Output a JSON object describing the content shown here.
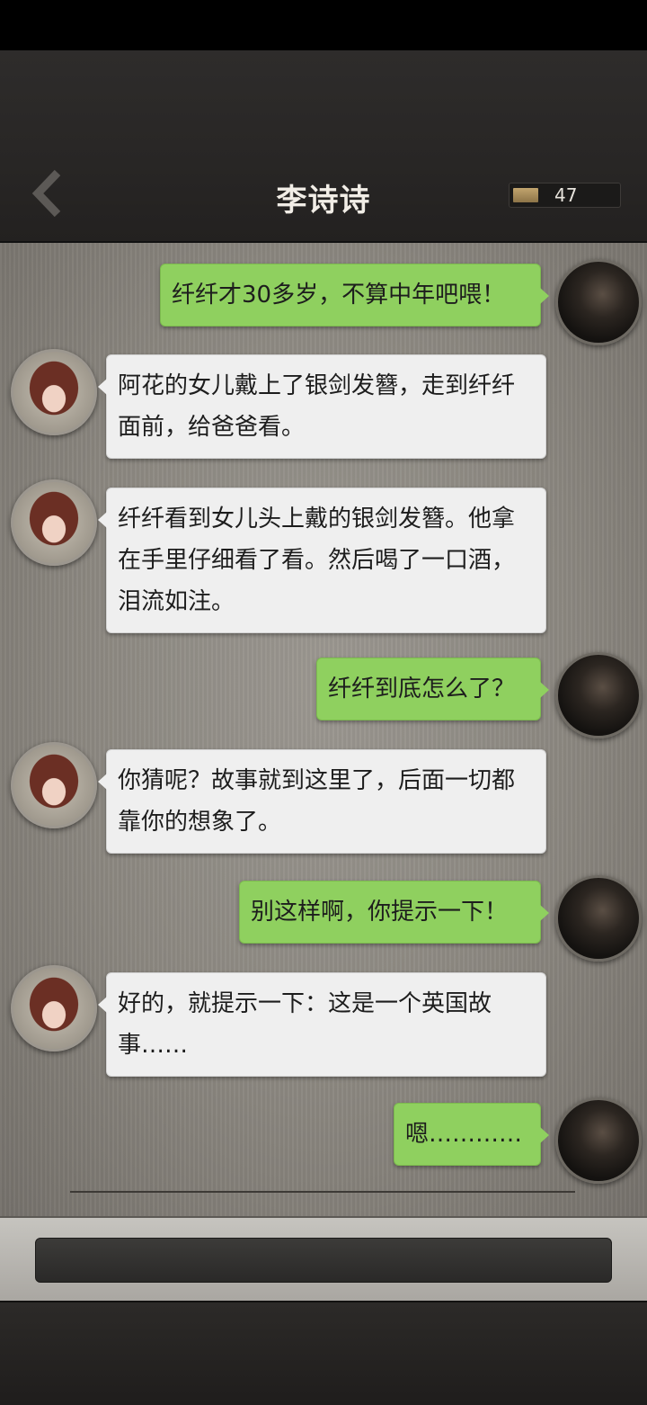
{
  "header": {
    "title": "李诗诗",
    "counter_value": "47"
  },
  "messages": [
    {
      "sender": "user",
      "text": "纤纤才30多岁，不算中年吧喂！"
    },
    {
      "sender": "npc",
      "text": "阿花的女儿戴上了银剑发簪，走到纤纤面前，给爸爸看。"
    },
    {
      "sender": "npc",
      "text": "纤纤看到女儿头上戴的银剑发簪。他拿在手里仔细看了看。然后喝了一口酒，泪流如注。"
    },
    {
      "sender": "user",
      "text": "纤纤到底怎么了？"
    },
    {
      "sender": "npc",
      "text": "你猜呢？故事就到这里了，后面一切都靠你的想象了。"
    },
    {
      "sender": "user",
      "text": "别这样啊，你提示一下！"
    },
    {
      "sender": "npc",
      "text": "好的，就提示一下：这是一个英国故事……"
    },
    {
      "sender": "user",
      "text": "嗯…………"
    }
  ],
  "icons": {
    "back": "chevron-left-icon",
    "counter": "gold-bar-icon"
  }
}
